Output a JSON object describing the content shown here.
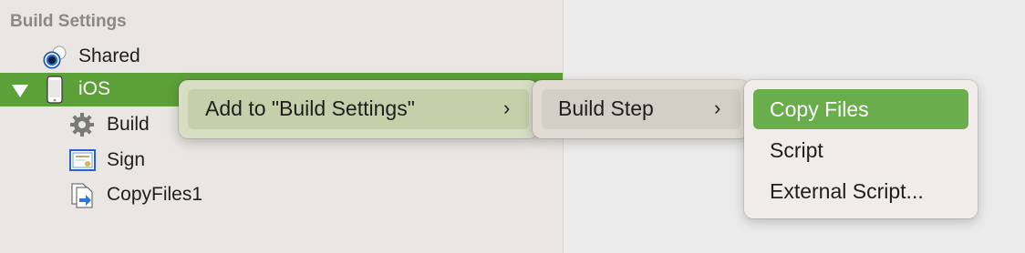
{
  "sidebar": {
    "header": "Build Settings",
    "items": [
      {
        "label": "Shared",
        "icon": "shared-icon"
      },
      {
        "label": "iOS",
        "icon": "iphone-icon",
        "selected": true,
        "expanded": true
      },
      {
        "label": "Build",
        "icon": "gear-icon"
      },
      {
        "label": "Sign",
        "icon": "certificate-icon"
      },
      {
        "label": "CopyFiles1",
        "icon": "copy-files-icon"
      }
    ]
  },
  "context_menu": {
    "level1": {
      "label": "Add to \"Build Settings\"",
      "submenu_icon": "chevron-right-icon"
    },
    "level2": {
      "label": "Build Step",
      "submenu_icon": "chevron-right-icon"
    },
    "level3": {
      "items": [
        "Copy Files",
        "Script",
        "External Script..."
      ],
      "highlighted_index": 0
    }
  },
  "colors": {
    "selection": "#5ca03a",
    "highlight": "#69ad4c"
  }
}
